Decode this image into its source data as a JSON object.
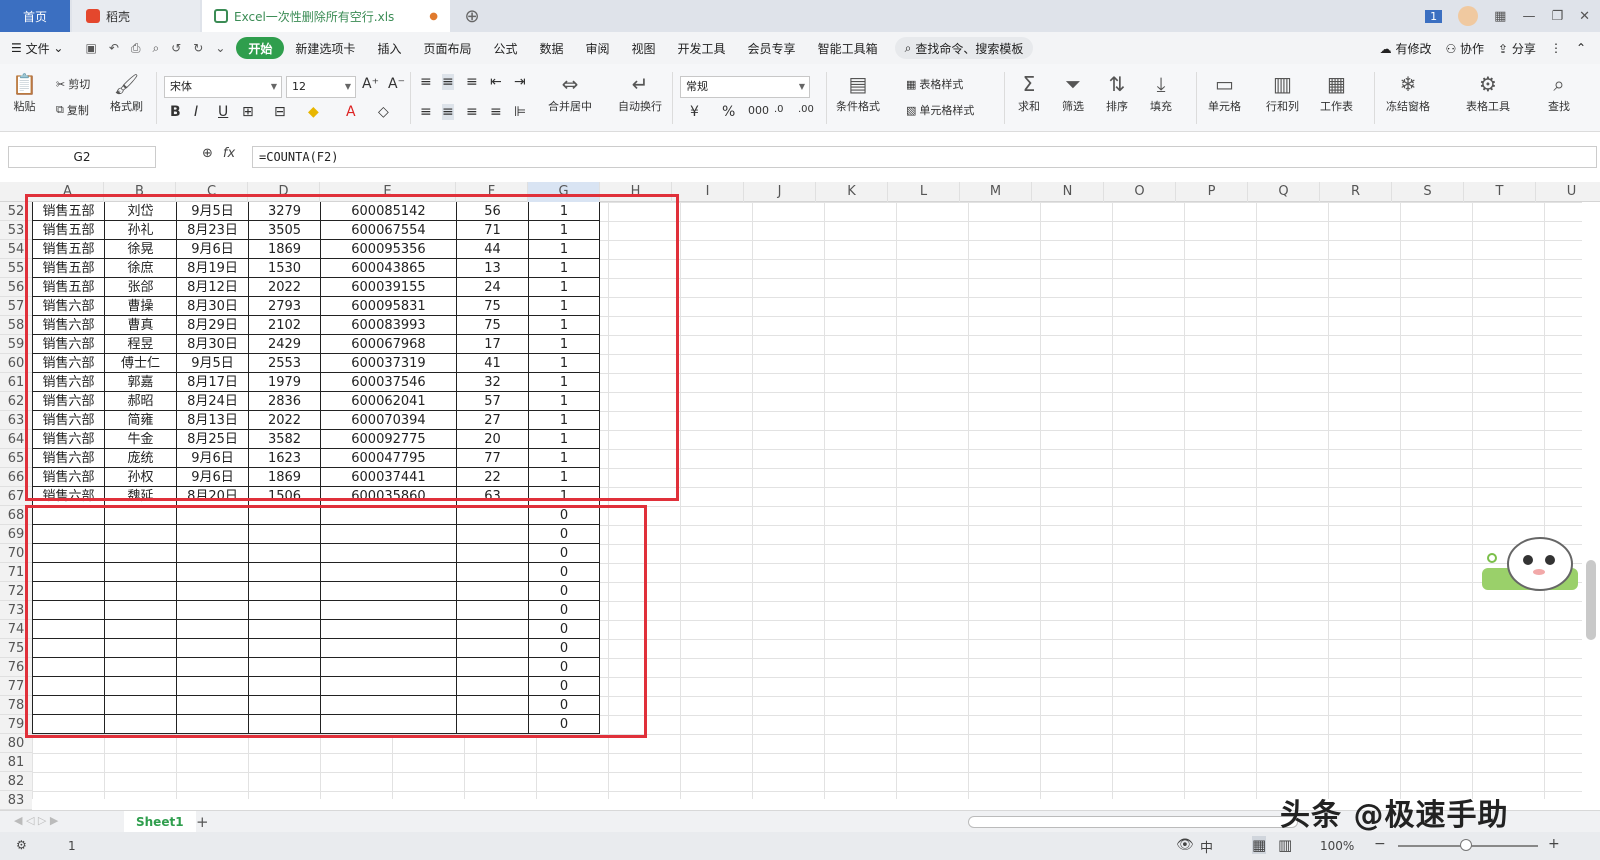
{
  "tabs": {
    "home": "首页",
    "daoke": "稻壳",
    "file": "Excel一次性删除所有空行.xls",
    "file_dot": "●",
    "badge": "1"
  },
  "menu": {
    "file": "文件",
    "items": [
      "开始",
      "新建选项卡",
      "插入",
      "页面布局",
      "公式",
      "数据",
      "审阅",
      "视图",
      "开发工具",
      "会员专享",
      "智能工具箱"
    ],
    "search": "查找命令、搜索模板",
    "has_changes": "有修改",
    "collab": "协作",
    "share": "分享"
  },
  "ribbon": {
    "paste": "粘贴",
    "cut": "剪切",
    "copy": "复制",
    "format_painter": "格式刷",
    "font": "宋体",
    "size": "12",
    "merge_center": "合并居中",
    "wrap": "自动换行",
    "number_format": "常规",
    "cond_format": "条件格式",
    "table_style": "表格样式",
    "cell_style": "单元格样式",
    "sum": "求和",
    "filter": "筛选",
    "sort": "排序",
    "fill": "填充",
    "cell": "单元格",
    "rowcol": "行和列",
    "sheet": "工作表",
    "freeze": "冻结窗格",
    "table_tools": "表格工具",
    "find": "查找"
  },
  "formula_bar": {
    "name_box": "G2",
    "fx": "fx",
    "formula": "=COUNTA(F2)"
  },
  "columns": [
    "A",
    "B",
    "C",
    "D",
    "E",
    "F",
    "G",
    "H",
    "I",
    "J",
    "K",
    "L",
    "M",
    "N",
    "O",
    "P",
    "Q",
    "R",
    "S",
    "T",
    "U"
  ],
  "row_numbers": [
    "52",
    "53",
    "54",
    "55",
    "56",
    "57",
    "58",
    "59",
    "60",
    "61",
    "62",
    "63",
    "64",
    "65",
    "66",
    "67",
    "68",
    "69",
    "70",
    "71",
    "72",
    "73",
    "74",
    "75",
    "76",
    "77",
    "78",
    "79",
    "80",
    "81",
    "82",
    "83"
  ],
  "data_rows": [
    [
      "销售五部",
      "刘岱",
      "9月5日",
      "3279",
      "600085142",
      "56",
      "1"
    ],
    [
      "销售五部",
      "孙礼",
      "8月23日",
      "3505",
      "600067554",
      "71",
      "1"
    ],
    [
      "销售五部",
      "徐晃",
      "9月6日",
      "1869",
      "600095356",
      "44",
      "1"
    ],
    [
      "销售五部",
      "徐庶",
      "8月19日",
      "1530",
      "600043865",
      "13",
      "1"
    ],
    [
      "销售五部",
      "张郃",
      "8月12日",
      "2022",
      "600039155",
      "24",
      "1"
    ],
    [
      "销售六部",
      "曹操",
      "8月30日",
      "2793",
      "600095831",
      "75",
      "1"
    ],
    [
      "销售六部",
      "曹真",
      "8月29日",
      "2102",
      "600083993",
      "75",
      "1"
    ],
    [
      "销售六部",
      "程昱",
      "8月30日",
      "2429",
      "600067968",
      "17",
      "1"
    ],
    [
      "销售六部",
      "傅士仁",
      "9月5日",
      "2553",
      "600037319",
      "41",
      "1"
    ],
    [
      "销售六部",
      "郭嘉",
      "8月17日",
      "1979",
      "600037546",
      "32",
      "1"
    ],
    [
      "销售六部",
      "郝昭",
      "8月24日",
      "2836",
      "600062041",
      "57",
      "1"
    ],
    [
      "销售六部",
      "简雍",
      "8月13日",
      "2022",
      "600070394",
      "27",
      "1"
    ],
    [
      "销售六部",
      "牛金",
      "8月25日",
      "3582",
      "600092775",
      "20",
      "1"
    ],
    [
      "销售六部",
      "庞统",
      "9月6日",
      "1623",
      "600047795",
      "77",
      "1"
    ],
    [
      "销售六部",
      "孙权",
      "9月6日",
      "1869",
      "600037441",
      "22",
      "1"
    ],
    [
      "销售六部",
      "魏延",
      "8月20日",
      "1506",
      "600035860",
      "63",
      "1"
    ],
    [
      "",
      "",
      "",
      "",
      "",
      "",
      "0"
    ],
    [
      "",
      "",
      "",
      "",
      "",
      "",
      "0"
    ],
    [
      "",
      "",
      "",
      "",
      "",
      "",
      "0"
    ],
    [
      "",
      "",
      "",
      "",
      "",
      "",
      "0"
    ],
    [
      "",
      "",
      "",
      "",
      "",
      "",
      "0"
    ],
    [
      "",
      "",
      "",
      "",
      "",
      "",
      "0"
    ],
    [
      "",
      "",
      "",
      "",
      "",
      "",
      "0"
    ],
    [
      "",
      "",
      "",
      "",
      "",
      "",
      "0"
    ],
    [
      "",
      "",
      "",
      "",
      "",
      "",
      "0"
    ],
    [
      "",
      "",
      "",
      "",
      "",
      "",
      "0"
    ],
    [
      "",
      "",
      "",
      "",
      "",
      "",
      "0"
    ],
    [
      "",
      "",
      "",
      "",
      "",
      "",
      "0"
    ]
  ],
  "sheet": {
    "name": "Sheet1",
    "add": "+"
  },
  "status": {
    "page": "1",
    "zoom": "100%"
  },
  "watermark": "头条 @极速手助",
  "colors": {
    "accent_green": "#2f9e4d",
    "highlight_red": "#e0303a",
    "home_tab": "#3b6fc1"
  }
}
